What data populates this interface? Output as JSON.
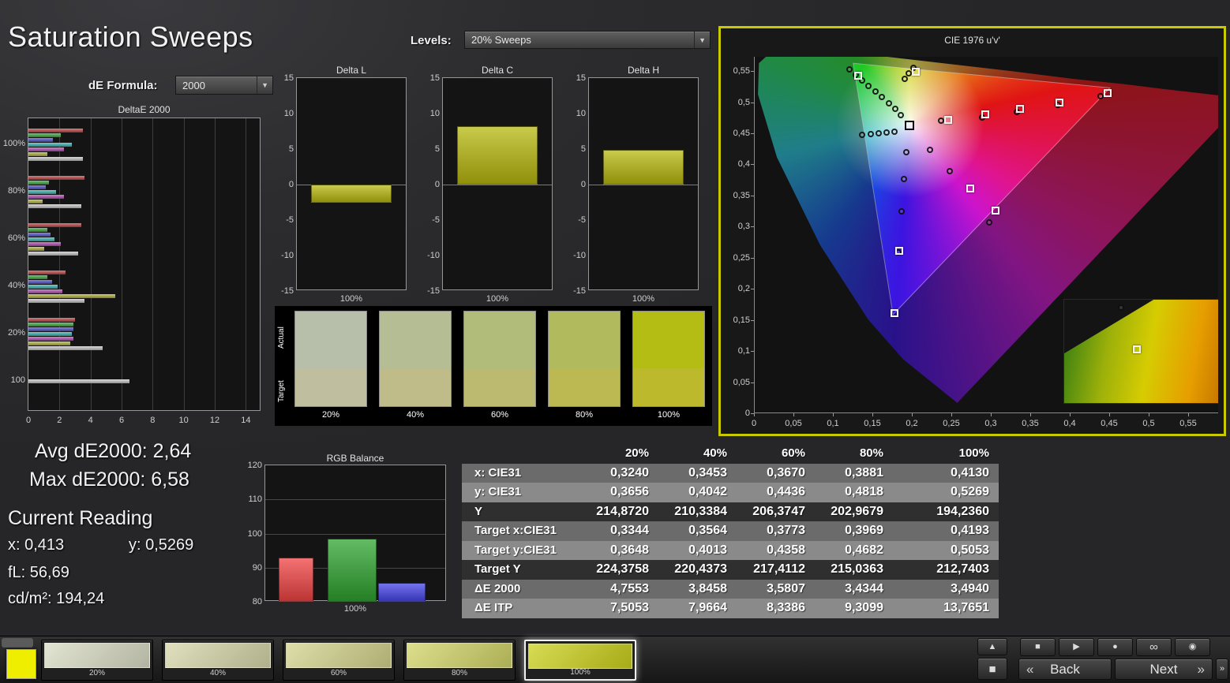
{
  "page": {
    "title": "Saturation Sweeps"
  },
  "controls": {
    "de_formula_label": "dE Formula:",
    "de_formula_value": "2000",
    "levels_label": "Levels:",
    "levels_value": "20% Sweeps"
  },
  "readouts": {
    "avg_de2000": "Avg dE2000: 2,64",
    "max_de2000": "Max dE2000: 6,58",
    "current_reading_title": "Current Reading",
    "x_value": "x: 0,413",
    "y_value": "y: 0,5269",
    "fl_value": "fL: 56,69",
    "cdm2_value": "cd/m²: 194,24"
  },
  "swatch_strip": {
    "actual_label": "Actual",
    "target_label": "Target",
    "patches": [
      {
        "label": "20%",
        "actual": "#b7bfaa",
        "target": "#bfbfa0"
      },
      {
        "label": "40%",
        "actual": "#b4bd94",
        "target": "#bfbc89"
      },
      {
        "label": "60%",
        "actual": "#b2bc7a",
        "target": "#bcb970"
      },
      {
        "label": "80%",
        "actual": "#b1bb5e",
        "target": "#bcb953"
      },
      {
        "label": "100%",
        "actual": "#b3bd14",
        "target": "#bcb92c"
      }
    ]
  },
  "table": {
    "columns": [
      "",
      "20%",
      "40%",
      "60%",
      "80%",
      "100%"
    ],
    "rows": [
      {
        "label": "x: CIE31",
        "values": [
          "0,3240",
          "0,3453",
          "0,3670",
          "0,3881",
          "0,4130"
        ]
      },
      {
        "label": "y: CIE31",
        "values": [
          "0,3656",
          "0,4042",
          "0,4436",
          "0,4818",
          "0,5269"
        ]
      },
      {
        "label": "Y",
        "values": [
          "214,8720",
          "210,3384",
          "206,3747",
          "202,9679",
          "194,2360"
        ]
      },
      {
        "label": "Target x:CIE31",
        "values": [
          "0,3344",
          "0,3564",
          "0,3773",
          "0,3969",
          "0,4193"
        ]
      },
      {
        "label": "Target y:CIE31",
        "values": [
          "0,3648",
          "0,4013",
          "0,4358",
          "0,4682",
          "0,5053"
        ]
      },
      {
        "label": "Target Y",
        "values": [
          "224,3758",
          "220,4373",
          "217,4112",
          "215,0363",
          "212,7403"
        ]
      },
      {
        "label": "ΔE 2000",
        "values": [
          "4,7553",
          "3,8458",
          "3,5807",
          "3,4344",
          "3,4940"
        ]
      },
      {
        "label": "ΔE ITP",
        "values": [
          "7,5053",
          "7,9664",
          "8,3386",
          "9,3099",
          "13,7651"
        ]
      }
    ]
  },
  "bottom_bar": {
    "current_patch_color": "#f0ee00",
    "patches": [
      {
        "label": "20%",
        "color": "#d9dcc4"
      },
      {
        "label": "40%",
        "color": "#d6d6a9"
      },
      {
        "label": "60%",
        "color": "#d3d38c"
      },
      {
        "label": "80%",
        "color": "#d2d467"
      },
      {
        "label": "100%",
        "color": "#cbd01b"
      }
    ],
    "selected_index": 4,
    "back_label": "Back",
    "next_label": "Next",
    "back_chevron": "«",
    "next_chevron": "»",
    "ff_chevron": "»",
    "icons": {
      "eject": "▲",
      "stop_large": "■",
      "stop": "■",
      "play": "▶",
      "record": "●",
      "loop": "∞",
      "power": "◉"
    }
  },
  "chart_data": [
    {
      "type": "bar",
      "title": "DeltaE 2000",
      "orientation": "horizontal",
      "xlim": [
        0,
        15
      ],
      "xticks": [
        0,
        2,
        4,
        6,
        8,
        10,
        12,
        14
      ],
      "series_colors": {
        "red": "#c04545",
        "green": "#3da83d",
        "blue": "#5252cc",
        "cyan": "#3db4b4",
        "magenta": "#b44fb4",
        "yellow": "#b4b43d",
        "white": "#c9c9c9"
      },
      "groups": [
        {
          "label": "100%",
          "bars": [
            [
              "red",
              3.5
            ],
            [
              "green",
              2.1
            ],
            [
              "blue",
              1.6
            ],
            [
              "cyan",
              2.8
            ],
            [
              "magenta",
              2.3
            ],
            [
              "yellow",
              1.2
            ],
            [
              "white",
              3.5
            ]
          ]
        },
        {
          "label": "80%",
          "bars": [
            [
              "red",
              3.6
            ],
            [
              "green",
              1.3
            ],
            [
              "blue",
              1.1
            ],
            [
              "cyan",
              1.8
            ],
            [
              "magenta",
              2.3
            ],
            [
              "yellow",
              0.9
            ],
            [
              "white",
              3.4
            ]
          ]
        },
        {
          "label": "60%",
          "bars": [
            [
              "red",
              3.4
            ],
            [
              "green",
              1.2
            ],
            [
              "blue",
              1.4
            ],
            [
              "cyan",
              1.7
            ],
            [
              "magenta",
              2.1
            ],
            [
              "yellow",
              1.0
            ],
            [
              "white",
              3.2
            ]
          ]
        },
        {
          "label": "40%",
          "bars": [
            [
              "red",
              2.4
            ],
            [
              "green",
              1.2
            ],
            [
              "blue",
              1.5
            ],
            [
              "cyan",
              1.9
            ],
            [
              "magenta",
              2.2
            ],
            [
              "yellow",
              5.6
            ],
            [
              "white",
              3.6
            ]
          ]
        },
        {
          "label": "20%",
          "bars": [
            [
              "red",
              3.0
            ],
            [
              "green",
              2.9
            ],
            [
              "blue",
              2.9
            ],
            [
              "cyan",
              2.8
            ],
            [
              "magenta",
              2.9
            ],
            [
              "yellow",
              2.7
            ],
            [
              "white",
              4.8
            ]
          ]
        },
        {
          "label": "100",
          "bars": [
            [
              "white",
              6.5
            ]
          ]
        }
      ]
    },
    {
      "type": "bar",
      "title": "Delta L",
      "categories": [
        "100%"
      ],
      "values": [
        -2.6
      ],
      "ylim": [
        -15,
        15
      ],
      "yticks": [
        15,
        10,
        5,
        0,
        -5,
        -10,
        -15
      ],
      "bar_color": "#b8b80e"
    },
    {
      "type": "bar",
      "title": "Delta C",
      "categories": [
        "100%"
      ],
      "values": [
        8.2
      ],
      "ylim": [
        -15,
        15
      ],
      "yticks": [
        15,
        10,
        5,
        0,
        -5,
        -10,
        -15
      ],
      "bar_color": "#b8b80e"
    },
    {
      "type": "bar",
      "title": "Delta H",
      "categories": [
        "100%"
      ],
      "values": [
        4.9
      ],
      "ylim": [
        -15,
        15
      ],
      "yticks": [
        15,
        10,
        5,
        0,
        -5,
        -10,
        -15
      ],
      "bar_color": "#b8b80e"
    },
    {
      "type": "bar",
      "title": "RGB Balance",
      "categories": [
        "100%"
      ],
      "ylim": [
        80,
        120
      ],
      "yticks": [
        120,
        110,
        100,
        90,
        80
      ],
      "gridlines": [
        90,
        100,
        110
      ],
      "series": [
        {
          "name": "red",
          "color": "#f04343",
          "values": [
            93.0
          ]
        },
        {
          "name": "green",
          "color": "#2fa42f",
          "values": [
            98.5
          ]
        },
        {
          "name": "blue",
          "color": "#4545e8",
          "values": [
            85.5
          ]
        }
      ]
    },
    {
      "type": "scatter",
      "title": "CIE 1976 u'v'",
      "xlim": [
        0,
        0.588
      ],
      "ylim": [
        0,
        0.573
      ],
      "tick_values": [
        0,
        0.05,
        0.1,
        0.15,
        0.2,
        0.25,
        0.3,
        0.35,
        0.4,
        0.45,
        0.5,
        0.55
      ],
      "tick_labels": [
        "0",
        "0,05",
        "0,1",
        "0,15",
        "0,2",
        "0,25",
        "0,3",
        "0,35",
        "0,4",
        "0,45",
        "0,5",
        "0,55"
      ],
      "gamut_triangle": [
        [
          0.4507,
          0.5229
        ],
        [
          0.125,
          0.5625
        ],
        [
          0.1754,
          0.1579
        ]
      ],
      "white_point": {
        "u": 0.196,
        "v": 0.462
      },
      "measured_points": [
        [
          0.12,
          0.553
        ],
        [
          0.128,
          0.544
        ],
        [
          0.136,
          0.535
        ],
        [
          0.144,
          0.526
        ],
        [
          0.153,
          0.517
        ],
        [
          0.161,
          0.508
        ],
        [
          0.17,
          0.498
        ],
        [
          0.178,
          0.489
        ],
        [
          0.185,
          0.479
        ],
        [
          0.19,
          0.537
        ],
        [
          0.195,
          0.546
        ],
        [
          0.201,
          0.555
        ],
        [
          0.136,
          0.448
        ],
        [
          0.147,
          0.449
        ],
        [
          0.157,
          0.45
        ],
        [
          0.167,
          0.451
        ],
        [
          0.177,
          0.453
        ],
        [
          0.192,
          0.419
        ],
        [
          0.189,
          0.377
        ],
        [
          0.186,
          0.325
        ],
        [
          0.182,
          0.258
        ],
        [
          0.236,
          0.47
        ],
        [
          0.288,
          0.475
        ],
        [
          0.332,
          0.484
        ],
        [
          0.384,
          0.496
        ],
        [
          0.438,
          0.51
        ],
        [
          0.222,
          0.423
        ],
        [
          0.247,
          0.389
        ],
        [
          0.297,
          0.307
        ]
      ],
      "target_points": [
        [
          0.245,
          0.472
        ],
        [
          0.292,
          0.48
        ],
        [
          0.336,
          0.489
        ],
        [
          0.386,
          0.5
        ],
        [
          0.447,
          0.514
        ],
        [
          0.204,
          0.549
        ],
        [
          0.131,
          0.543
        ],
        [
          0.273,
          0.361
        ],
        [
          0.305,
          0.326
        ],
        [
          0.183,
          0.261
        ],
        [
          0.177,
          0.161
        ]
      ],
      "inset": {
        "circle": {
          "x_pct": 37,
          "y_pct": 8
        },
        "square": {
          "x_pct": 47,
          "y_pct": 48
        }
      }
    }
  ]
}
